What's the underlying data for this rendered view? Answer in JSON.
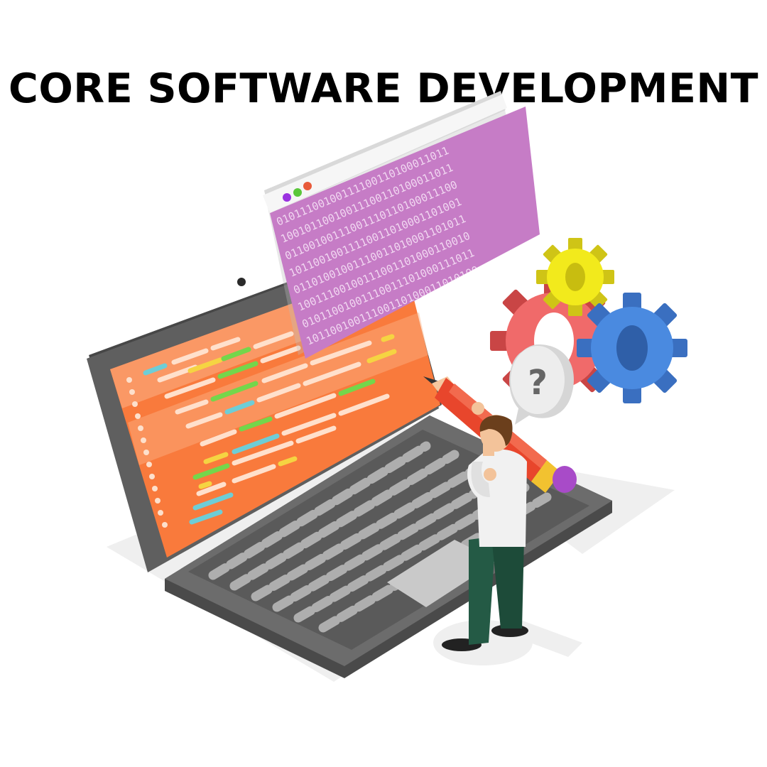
{
  "title": "CORE SOFTWARE DEVELOPMENT",
  "binary_rows": [
    "01011100100111100110100011011",
    "10010110010011100110100011011",
    "01100100111001110110100011100",
    "10110010011110011010001101001",
    "01101001001110011010001101011",
    "10011100100111001101000110010",
    "01011001001110011101000111011",
    "10110010011100110100011010100"
  ],
  "help_symbol": "?",
  "colors": {
    "laptop_screen": "#f97a3c",
    "laptop_body": "#5f5f5f",
    "binary_window": "#c67cc6",
    "gear_red": "#f06a6a",
    "gear_yellow": "#f2ea1c",
    "gear_blue": "#4a8ae0",
    "pencil": "#e8462c",
    "shirt": "#f1f1f1",
    "pants": "#245a45",
    "hair": "#6b3f1c"
  }
}
